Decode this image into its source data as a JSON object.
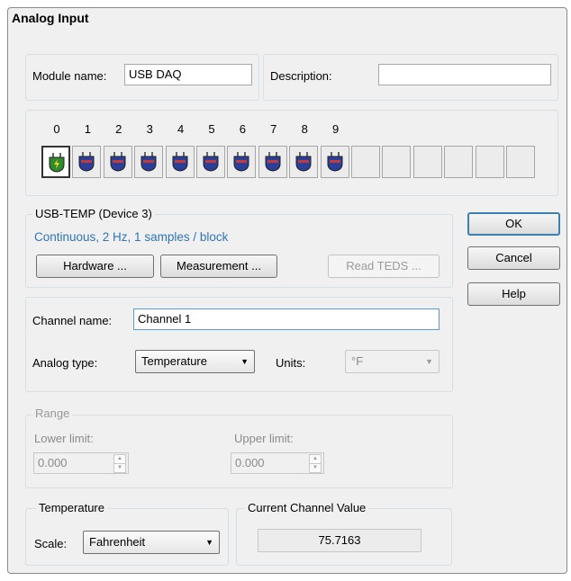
{
  "window": {
    "title": "Analog Input"
  },
  "module": {
    "name_label": "Module name:",
    "name_value": "USB DAQ",
    "description_label": "Description:",
    "description_value": ""
  },
  "channels": {
    "numbers": [
      "0",
      "1",
      "2",
      "3",
      "4",
      "5",
      "6",
      "7",
      "8",
      "9"
    ],
    "selected": "0",
    "used_count": 10,
    "empty_count": 6
  },
  "device": {
    "title": "USB-TEMP (Device 3)",
    "status": "Continuous, 2 Hz, 1 samples / block",
    "hardware_button": "Hardware ...",
    "measurement_button": "Measurement ...",
    "read_teds_button": "Read TEDS ..."
  },
  "side_buttons": {
    "ok": "OK",
    "cancel": "Cancel",
    "help": "Help"
  },
  "channel": {
    "name_label": "Channel name:",
    "name_value": "Channel 1",
    "type_label": "Analog type:",
    "type_value": "Temperature",
    "units_label": "Units:",
    "units_value": "°F"
  },
  "range": {
    "title": "Range",
    "lower_label": "Lower limit:",
    "lower_value": "0.000",
    "upper_label": "Upper limit:",
    "upper_value": "0.000"
  },
  "temperature": {
    "title": "Temperature",
    "scale_label": "Scale:",
    "scale_value": "Fahrenheit"
  },
  "current": {
    "title": "Current Channel Value",
    "value": "75.7163"
  },
  "colors": {
    "accent_text": "#2e75b6",
    "channel_active": "#2e8b2e",
    "channel_plug": "#2a3f9a"
  }
}
